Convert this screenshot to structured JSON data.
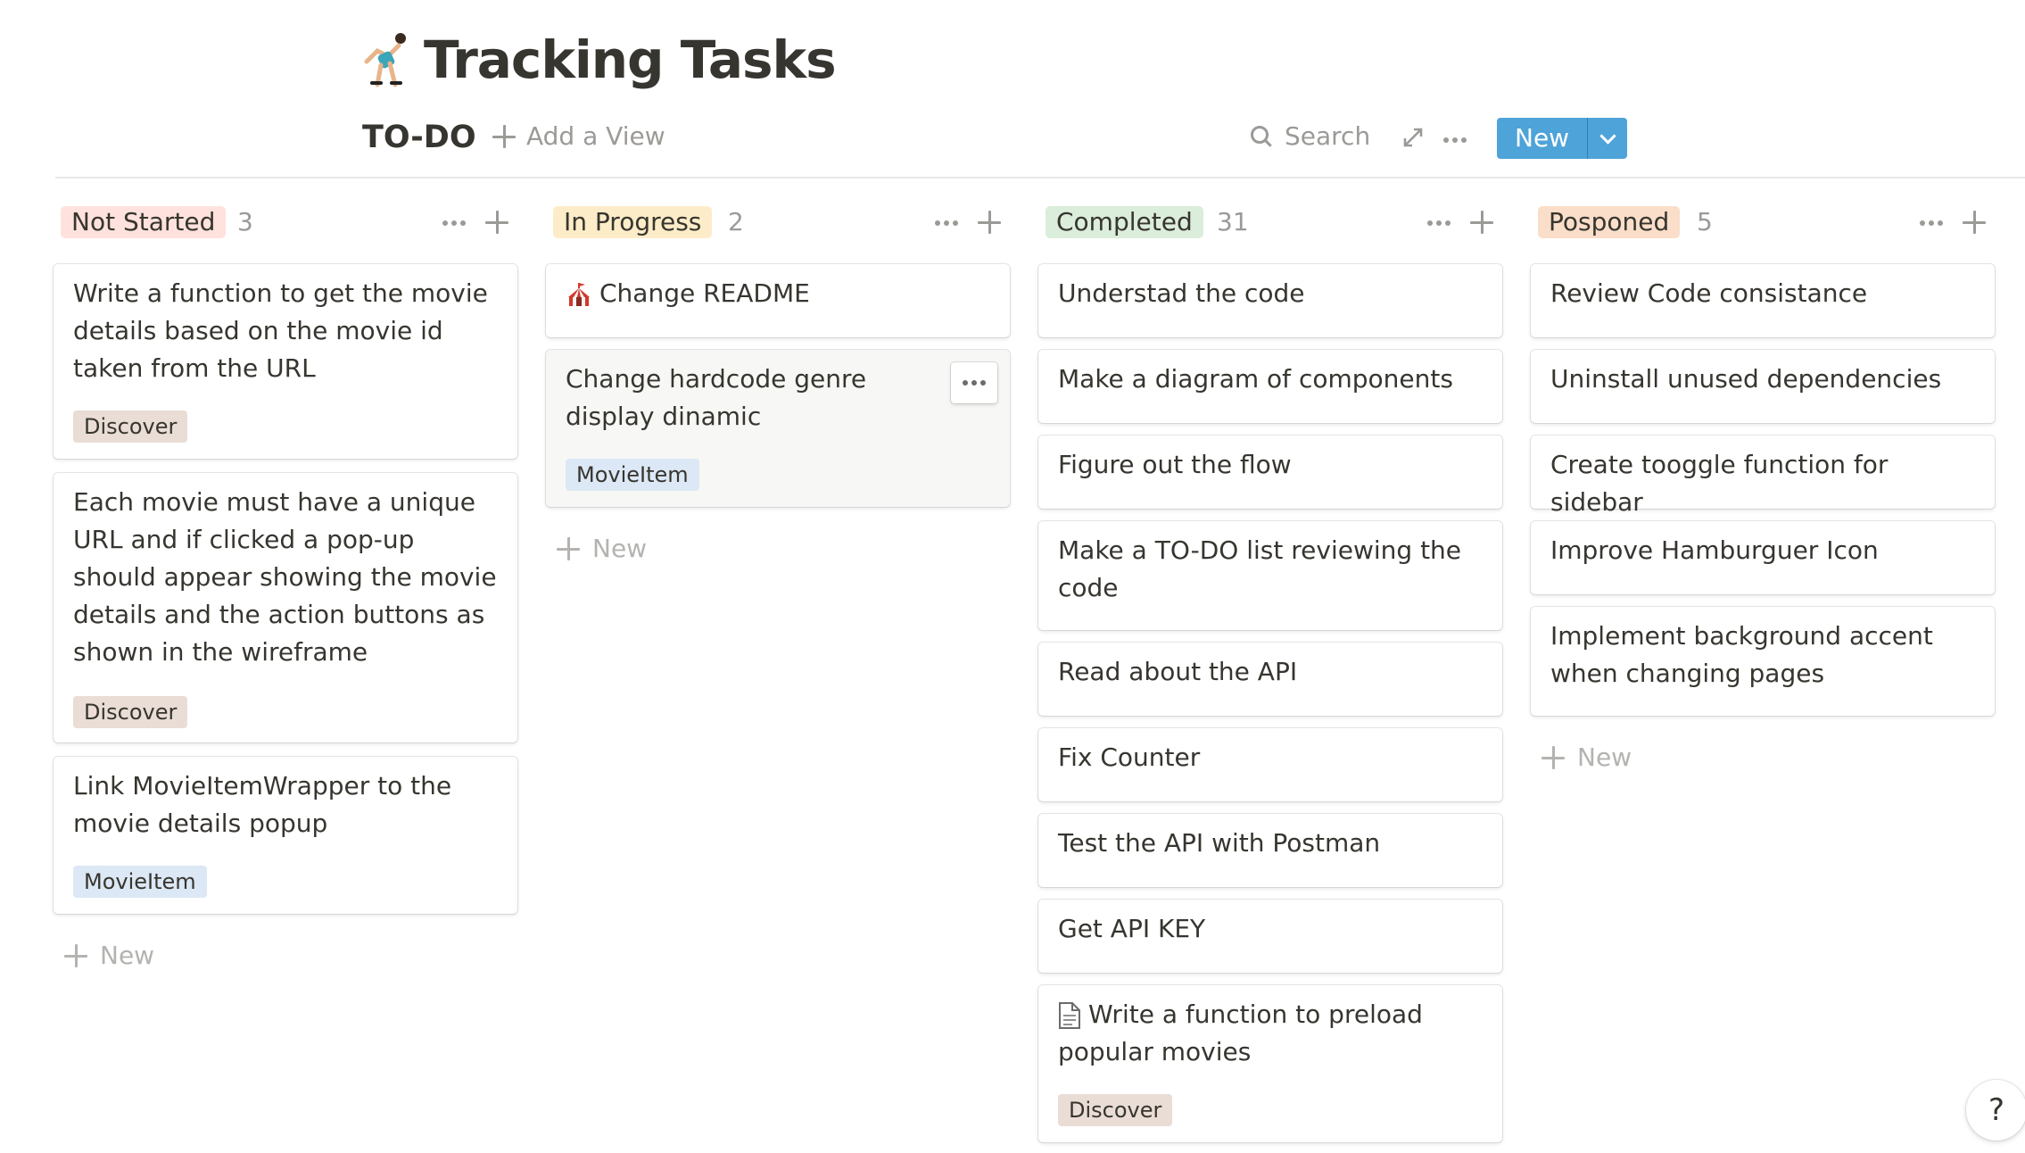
{
  "page": {
    "title": "Tracking Tasks",
    "icon": "person-cartwheeling-emoji-icon"
  },
  "toolbar": {
    "view_name": "TO-DO",
    "add_view_label": "Add a View",
    "search_label": "Search",
    "new_label": "New"
  },
  "columns": [
    {
      "status": "Not Started",
      "count": "3",
      "pill_color": "#ffe2dd",
      "cards": [
        {
          "title": "Write a function to get the movie details based on the movie id taken from the URL",
          "tag": "Discover"
        },
        {
          "title": "Each movie must have a unique URL and if clicked a pop-up should appear showing the movie details and the action buttons as shown in the wireframe",
          "tag": "Discover"
        },
        {
          "title": "Link MovieItemWrapper to the movie details popup",
          "tag": "MovieItem"
        }
      ],
      "new_label": "New"
    },
    {
      "status": "In Progress",
      "count": "2",
      "pill_color": "#fdecc8",
      "cards": [
        {
          "title": "Change README",
          "icon": "circus-tent-icon"
        },
        {
          "title": "Change hardcode genre display dinamic",
          "tag": "MovieItem"
        }
      ],
      "new_label": "New"
    },
    {
      "status": "Completed",
      "count": "31",
      "pill_color": "#dbeddb",
      "cards": [
        {
          "title": "Understad the code"
        },
        {
          "title": "Make a diagram of components"
        },
        {
          "title": "Figure out the flow"
        },
        {
          "title": "Make a TO-DO list reviewing the code"
        },
        {
          "title": "Read about the API"
        },
        {
          "title": "Fix Counter"
        },
        {
          "title": "Test the API with Postman"
        },
        {
          "title": "Get API KEY"
        },
        {
          "title": "Write a function to preload popular movies",
          "icon": "document-icon",
          "tag": "Discover"
        }
      ]
    },
    {
      "status": "Posponed",
      "count": "5",
      "pill_color": "#fadec9",
      "cards": [
        {
          "title": "Review Code consistance"
        },
        {
          "title": "Uninstall unused dependencies"
        },
        {
          "title": "Create tooggle function for sidebar"
        },
        {
          "title": "Improve Hamburguer Icon"
        },
        {
          "title": "Implement background accent when changing pages"
        }
      ],
      "new_label": "New"
    }
  ],
  "help": {
    "label": "?"
  },
  "colors": {
    "accent": "#4ea3d8",
    "tag_discover": "#e9ddd5",
    "tag_movieitem": "#dce8f5",
    "text": "#37352f",
    "muted": "#9b9a97"
  }
}
